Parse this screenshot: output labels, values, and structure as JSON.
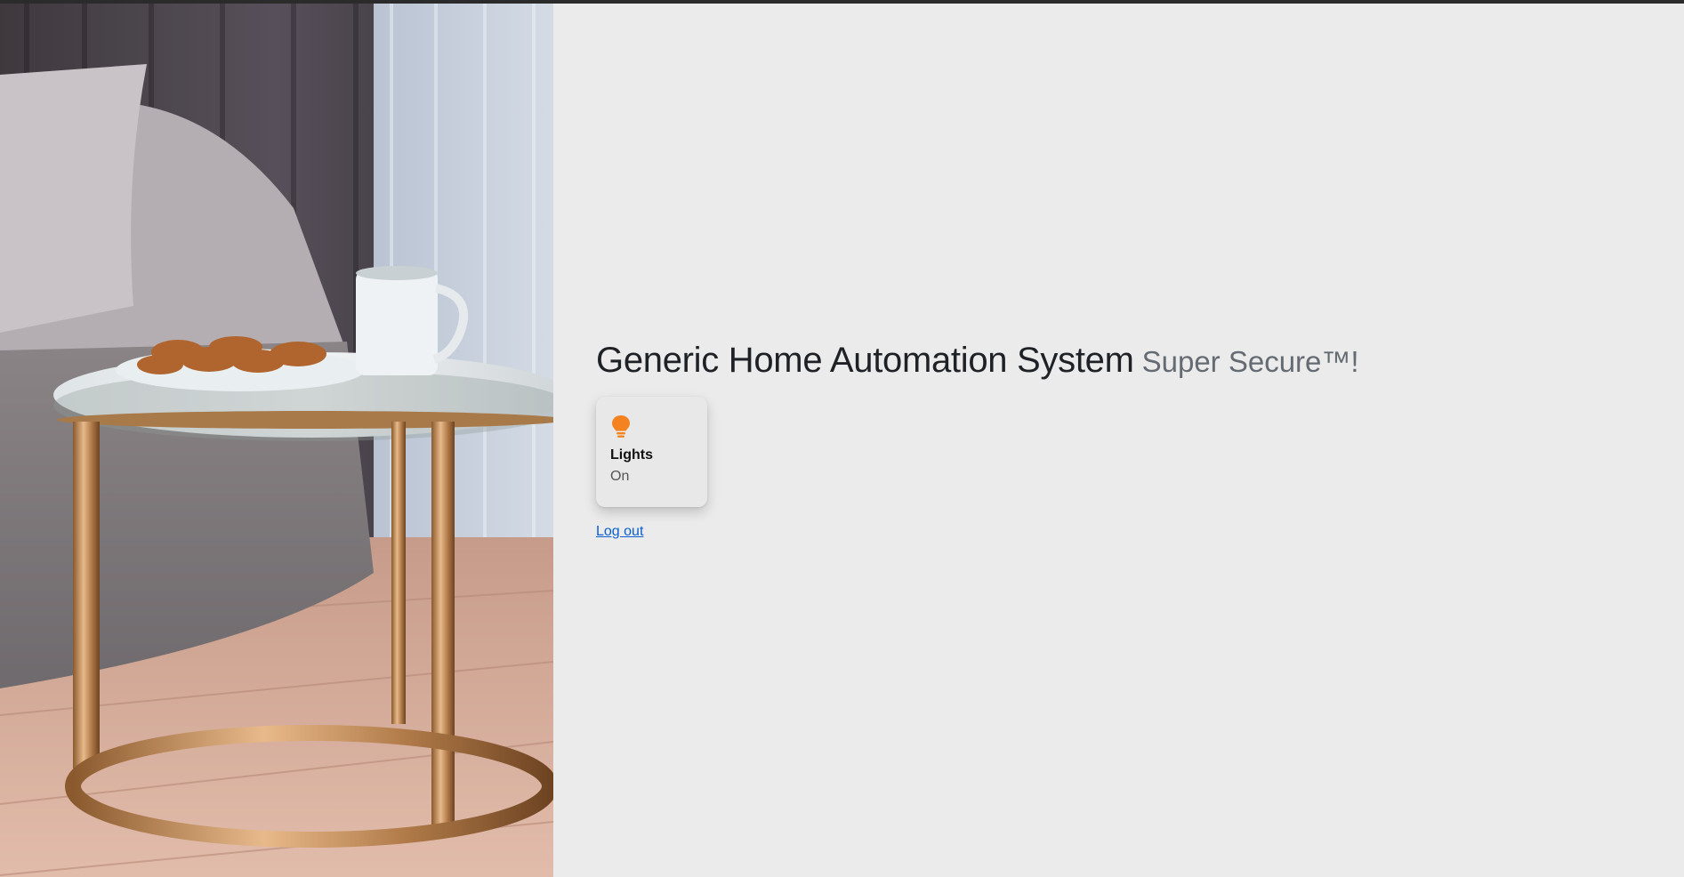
{
  "header": {
    "title": "Generic Home Automation System",
    "subtitle": "Super Secure™!"
  },
  "devices": [
    {
      "name": "Lights",
      "state": "On",
      "icon": "lightbulb-icon",
      "icon_color": "#f58220"
    }
  ],
  "actions": {
    "logout_label": "Log out"
  },
  "colors": {
    "background": "#ebebeb",
    "link": "#0b5fd0",
    "title": "#1e2125",
    "subtitle": "#646b72"
  },
  "hero_image": {
    "icon": "living-room-photo"
  }
}
